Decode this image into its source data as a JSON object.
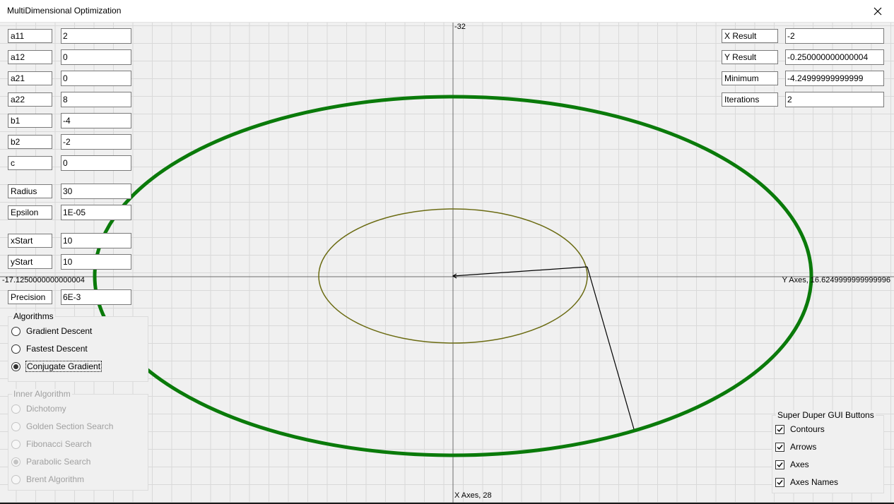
{
  "window": {
    "title": "MultiDimensional Optimization",
    "close_icon": "close-icon"
  },
  "params": [
    {
      "label": "a11",
      "value": "2"
    },
    {
      "label": "a12",
      "value": "0"
    },
    {
      "label": "a21",
      "value": "0"
    },
    {
      "label": "a22",
      "value": "8"
    },
    {
      "label": "b1",
      "value": "-4"
    },
    {
      "label": "b2",
      "value": "-2"
    },
    {
      "label": "c",
      "value": "0"
    },
    {
      "label": "Radius",
      "value": "30"
    },
    {
      "label": "Epsilon",
      "value": "1E-05"
    },
    {
      "label": "xStart",
      "value": "10"
    },
    {
      "label": "yStart",
      "value": "10"
    },
    {
      "label": "Precision",
      "value": "6E-3"
    }
  ],
  "results": [
    {
      "label": "X Result",
      "value": "-2"
    },
    {
      "label": "Y Result",
      "value": "-0.250000000000004"
    },
    {
      "label": "Minimum",
      "value": "-4.24999999999999"
    },
    {
      "label": "Iterations",
      "value": "2"
    }
  ],
  "algorithms": {
    "title": "Algorithms",
    "options": [
      "Gradient Descent",
      "Fastest Descent",
      "Conjugate Gradient"
    ],
    "selected": "Conjugate Gradient"
  },
  "inner_algorithm": {
    "title": "Inner Algorithm",
    "options": [
      "Dichotomy",
      "Golden Section Search",
      "Fibonacci Search",
      "Parabolic Search",
      "Brent Algorithm"
    ],
    "selected": "Parabolic Search",
    "enabled": false
  },
  "display_options": {
    "title": "Super Duper GUI Buttons",
    "options": [
      {
        "label": "Contours",
        "checked": true
      },
      {
        "label": "Arrows",
        "checked": true
      },
      {
        "label": "Axes",
        "checked": true
      },
      {
        "label": "Axes Names",
        "checked": true
      }
    ]
  },
  "axes": {
    "top": "-32",
    "left": "-17.1250000000000004",
    "right": "Y Axes, 16.6249999999999996",
    "bottom": "X Axes, 28"
  },
  "colors": {
    "outer_contour": "#0a7a0a",
    "inner_contour": "#6b6b12",
    "path": "#000000",
    "grid": "#d9d9d9",
    "background": "#f0f0f0"
  }
}
